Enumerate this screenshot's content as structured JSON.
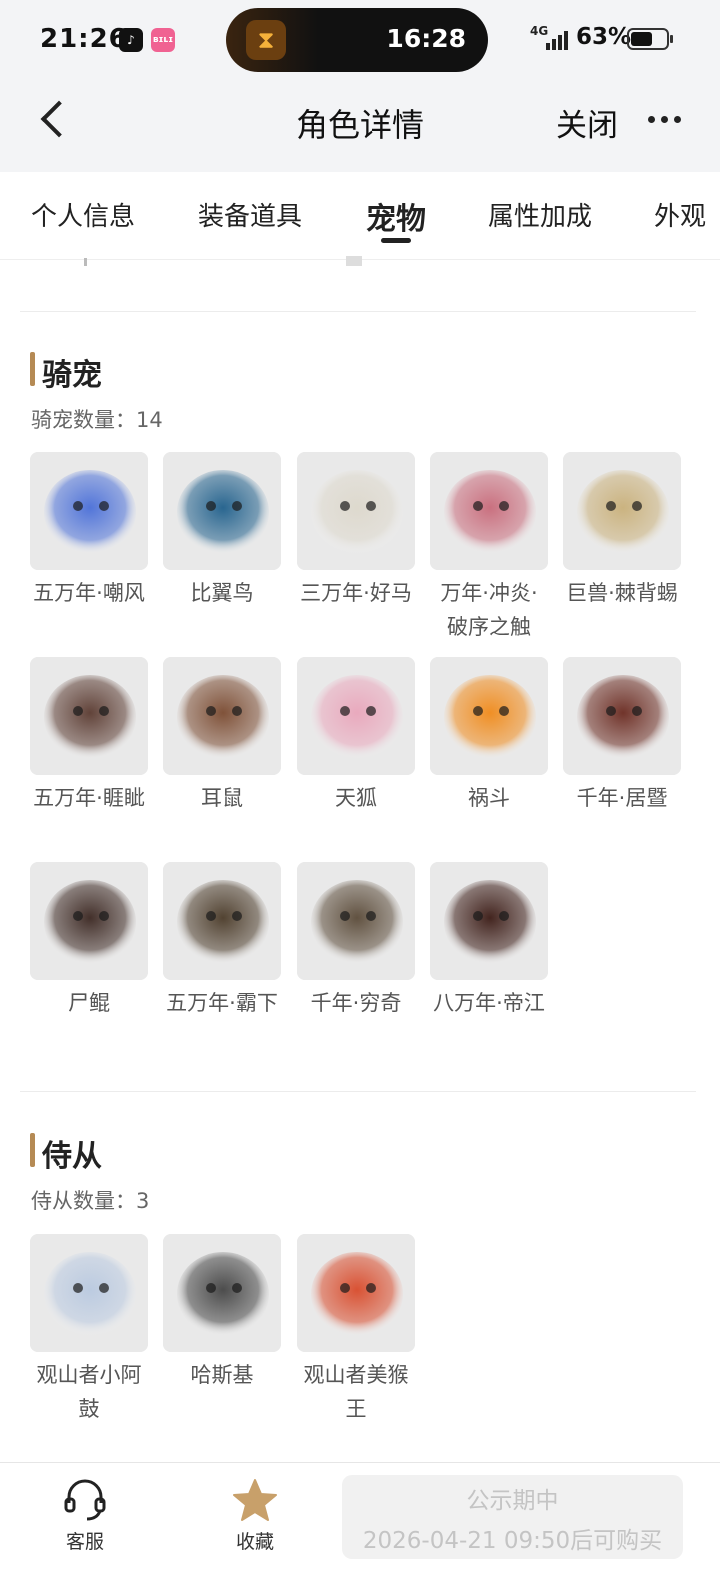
{
  "status_bar": {
    "time": "21:26",
    "app_icons": [
      "tiktok-icon",
      "bilibili-icon"
    ],
    "timer_time": "16:28",
    "network": "4G",
    "battery": "63%",
    "battery_level": 0.63
  },
  "header": {
    "title": "角色详情",
    "close_label": "关闭"
  },
  "tabs": [
    {
      "label": "个人信息"
    },
    {
      "label": "装备道具"
    },
    {
      "label": "宠物",
      "active": true
    },
    {
      "label": "属性加成"
    },
    {
      "label": "外观"
    }
  ],
  "mounts": {
    "title": "骑宠",
    "count_label": "骑宠数量：",
    "count": "14",
    "items": [
      {
        "name": "五万年·嘲风",
        "color": "#4a6fd8"
      },
      {
        "name": "比翼鸟",
        "color": "#1f5f8b"
      },
      {
        "name": "三万年·好马",
        "color": "#ddd8cc"
      },
      {
        "name": "万年·冲炎·破序之触",
        "color": "#c86a7a"
      },
      {
        "name": "巨兽·棘背蜴",
        "color": "#c9b07a"
      },
      {
        "name": "五万年·睚眦",
        "color": "#5a3a30"
      },
      {
        "name": "耳鼠",
        "color": "#7a4a30"
      },
      {
        "name": "天狐",
        "color": "#e9a6bb"
      },
      {
        "name": "祸斗",
        "color": "#f08a1a"
      },
      {
        "name": "千年·居暨",
        "color": "#6a2a20"
      },
      {
        "name": "尸鲲",
        "color": "#3a2620"
      },
      {
        "name": "五万年·霸下",
        "color": "#4a3a28"
      },
      {
        "name": "千年·穷奇",
        "color": "#5a4a38"
      },
      {
        "name": "八万年·帝江",
        "color": "#3a1a14"
      }
    ]
  },
  "attendants": {
    "title": "侍从",
    "count_label": "侍从数量：",
    "count": "3",
    "items": [
      {
        "name": "观山者小阿鼓",
        "color": "#b9c9e0"
      },
      {
        "name": "哈斯基",
        "color": "#444444"
      },
      {
        "name": "观山者美猴王",
        "color": "#d84a2a"
      }
    ]
  },
  "bottom_bar": {
    "service_label": "客服",
    "favorite_label": "收藏",
    "buy_line1": "公示期中",
    "buy_line2": "2026-04-21 09:50后可购买",
    "favorite_color": "#c8a06a"
  }
}
